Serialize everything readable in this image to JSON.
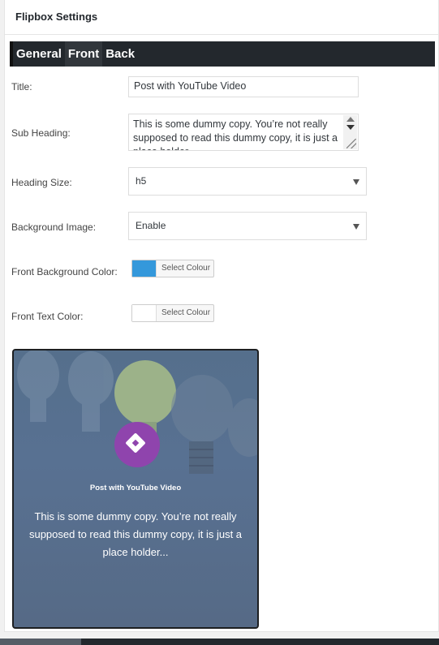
{
  "panel": {
    "title": "Flipbox Settings"
  },
  "tabs": [
    {
      "label": "General",
      "active": false
    },
    {
      "label": "Front",
      "active": true
    },
    {
      "label": "Back",
      "active": false
    }
  ],
  "fields": {
    "title": {
      "label": "Title:",
      "value": "Post with YouTube Video"
    },
    "sub_heading": {
      "label": "Sub Heading:",
      "value": "This is some dummy copy. You’re not really supposed to read this dummy copy, it is just a place holder..."
    },
    "heading_size": {
      "label": "Heading Size:",
      "value": "h5"
    },
    "background_image": {
      "label": "Background Image:",
      "value": "Enable"
    },
    "front_bg_color": {
      "label": "Front Background Color:",
      "button": "Select Colour",
      "color": "#3498db"
    },
    "front_text_color": {
      "label": "Front Text Color:",
      "button": "Select Colour",
      "color": "#ffffff"
    }
  },
  "preview": {
    "icon": "diamond-icon",
    "title": "Post with YouTube Video",
    "body": "This is some dummy copy. You’re not really supposed to read this dummy copy, it is just a place holder...",
    "icon_color": "#8f44ad"
  }
}
